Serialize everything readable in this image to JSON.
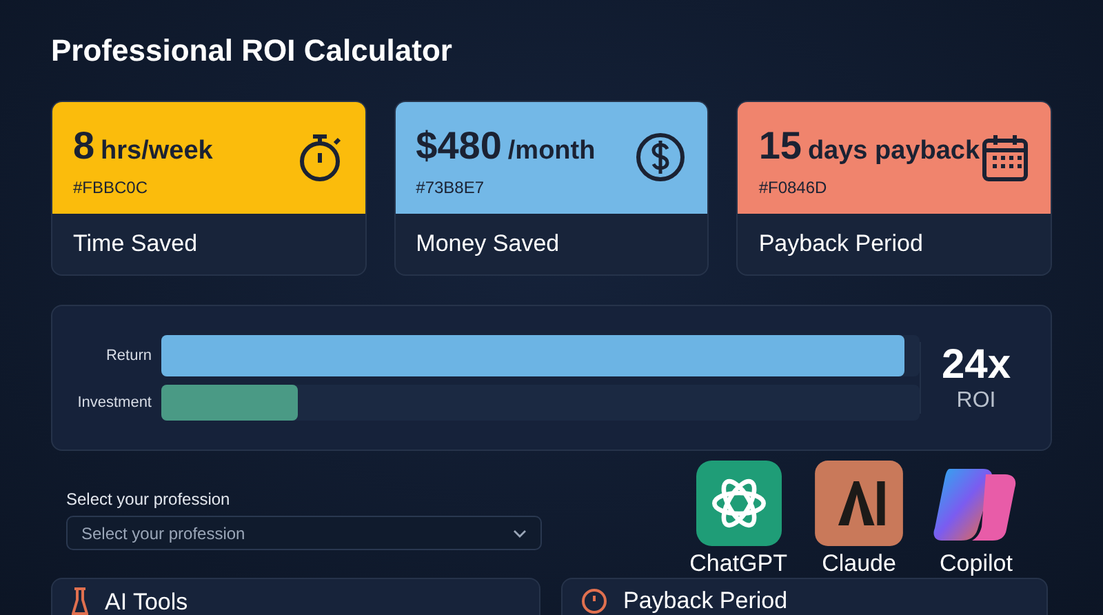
{
  "title": "Professional ROI Calculator",
  "metrics": [
    {
      "value": "8",
      "unit": "hrs/week",
      "code": "#FBBC0C",
      "label": "Time Saved",
      "color": "#fbbc0c",
      "kind": "stopwatch"
    },
    {
      "value": "$480",
      "unit": "/month",
      "code": "#73B8E7",
      "label": "Money Saved",
      "color": "#73b8e7",
      "kind": "dollar"
    },
    {
      "value": "15",
      "unit": "days payback",
      "code": "#F0846D",
      "label": "Payback Period",
      "color": "#f0846d",
      "kind": "calendar"
    }
  ],
  "comparison": {
    "bars": [
      {
        "label": "Return",
        "level": 0.98
      },
      {
        "label": "Investment",
        "level": 0.18
      }
    ],
    "roi_value": "24x",
    "roi_label": "ROI"
  },
  "profession": {
    "label": "Select your profession",
    "placeholder": "Select your profession"
  },
  "tools": [
    {
      "name": "ChatGPT",
      "kind": "knot"
    },
    {
      "name": "Claude",
      "kind": "letters"
    },
    {
      "name": "Copilot",
      "kind": "ribbon"
    }
  ],
  "panels": [
    {
      "title": "AI Tools",
      "kind": "flask"
    },
    {
      "title": "Payback Period",
      "kind": "clock"
    }
  ]
}
